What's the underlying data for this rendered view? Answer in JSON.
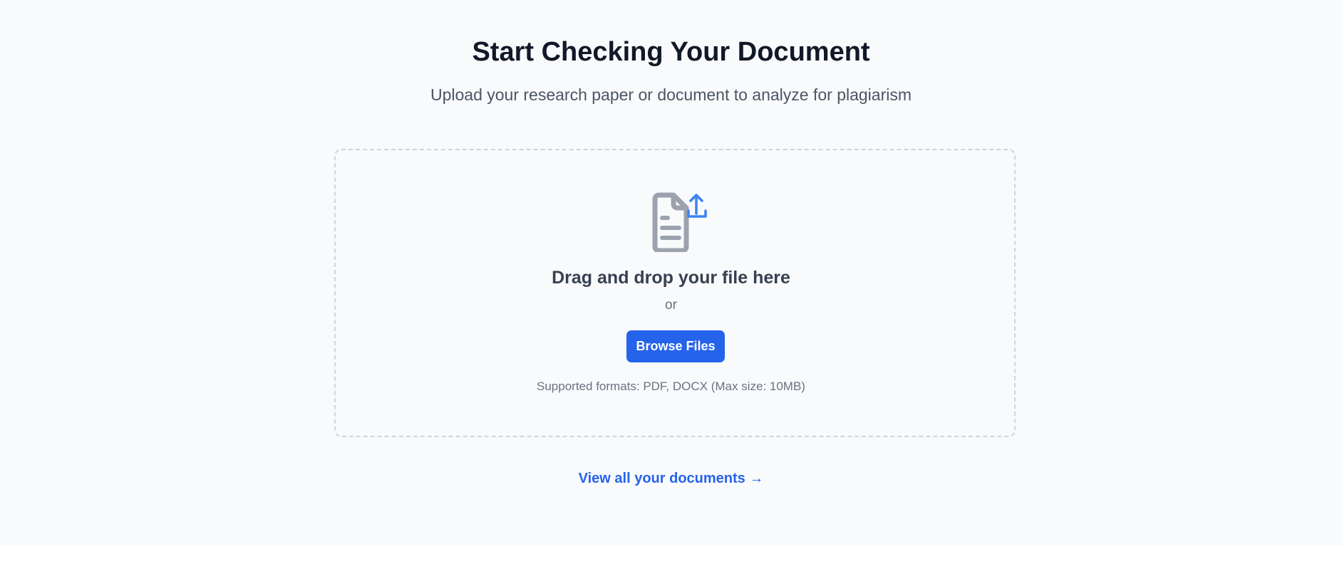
{
  "header": {
    "title": "Start Checking Your Document",
    "subtitle": "Upload your research paper or document to analyze for plagiarism"
  },
  "upload": {
    "icon": "document-upload-icon",
    "title": "Drag and drop your file here",
    "or_text": "or",
    "browse_label": "Browse Files",
    "formats_text": "Supported formats: PDF, DOCX (Max size: 10MB)"
  },
  "footer": {
    "view_all_label": "View all your documents →"
  },
  "colors": {
    "accent": "#2563eb",
    "background": "#f8fafc",
    "icon_gray": "#9ca3af"
  }
}
